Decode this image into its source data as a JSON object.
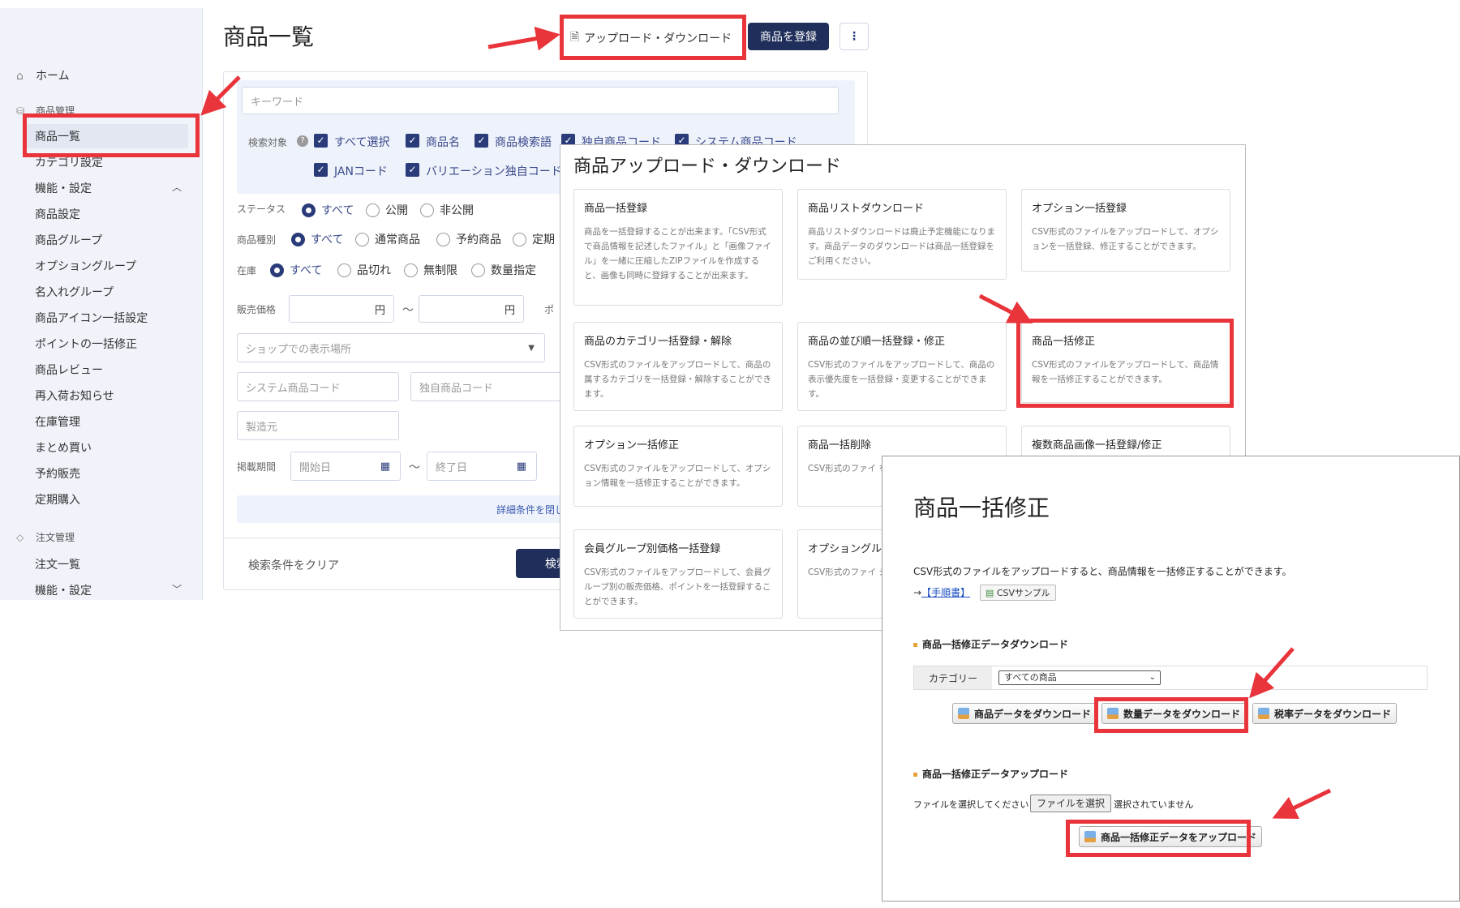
{
  "sidebar": {
    "home": "ホーム",
    "product_group": "商品管理",
    "product_items": [
      "商品一覧",
      "カテゴリ設定",
      "機能・設定",
      "商品設定",
      "商品グループ",
      "オプショングループ",
      "名入れグループ",
      "商品アイコン一括設定",
      "ポイントの一括修正",
      "商品レビュー",
      "再入荷お知らせ",
      "在庫管理",
      "まとめ買い",
      "予約販売",
      "定期購入"
    ],
    "order_group": "注文管理",
    "order_items": [
      "注文一覧",
      "機能・設定"
    ]
  },
  "main": {
    "title": "商品一覧",
    "upload_download_label": "アップロード・ダウンロード",
    "register_label": "商品を登録",
    "more_label": "⋮",
    "keyword_placeholder": "キーワード",
    "search_target_label": "検索対象",
    "search_targets": [
      "すべて選択",
      "商品名",
      "商品検索語",
      "独自商品コード",
      "システム商品コード",
      "JANコード",
      "バリエーション独自コード"
    ],
    "status_label": "ステータス",
    "status_options": [
      "すべて",
      "公開",
      "非公開"
    ],
    "type_label": "商品種別",
    "type_options": [
      "すべて",
      "通常商品",
      "予約商品",
      "定期"
    ],
    "stock_label": "在庫",
    "stock_options": [
      "すべて",
      "品切れ",
      "無制限",
      "数量指定"
    ],
    "price_label": "販売価格",
    "yen": "円",
    "tilde": "〜",
    "point_label": "ポ",
    "display_place_placeholder": "ショップでの表示場所",
    "system_code_placeholder": "システム商品コード",
    "own_code_placeholder": "独自商品コード",
    "maker_placeholder": "製造元",
    "period_label": "掲載期間",
    "start_date_placeholder": "開始日",
    "end_date_placeholder": "終了日",
    "detail_toggle": "詳細条件を閉じ",
    "clear_label": "検索条件をクリア",
    "search_label": "検索"
  },
  "dialog1": {
    "title": "商品アップロード・ダウンロード",
    "cards": [
      {
        "title": "商品一括登録",
        "desc": "商品を一括登録することが出来ます。「CSV形式で商品情報を記述したファイル」と「画像ファイル」を一緒に圧縮したZIPファイルを作成すると、画像も同時に登録することが出来ます。"
      },
      {
        "title": "商品リストダウンロード",
        "desc": "商品リストダウンロードは廃止予定機能になります。商品データのダウンロードは商品一括登録をご利用ください。"
      },
      {
        "title": "オプション一括登録",
        "desc": "CSV形式のファイルをアップロードして、オプションを一括登録、修正することができます。"
      },
      {
        "title": "商品のカテゴリ一括登録・解除",
        "desc": "CSV形式のファイルをアップロードして、商品の属するカテゴリを一括登録・解除することができます。"
      },
      {
        "title": "商品の並び順一括登録・修正",
        "desc": "CSV形式のファイルをアップロードして、商品の表示優先度を一括登録・変更することができます。"
      },
      {
        "title": "商品一括修正",
        "desc": "CSV形式のファイルをアップロードして、商品情報を一括修正することができます。"
      },
      {
        "title": "オプション一括修正",
        "desc": "CSV形式のファイルをアップロードして、オプション情報を一括修正することができます。"
      },
      {
        "title": "商品一括削除",
        "desc": "CSV形式のファイ を一括削除できま"
      },
      {
        "title": "複数商品画像一括登録/修正",
        "desc": ""
      },
      {
        "title": "会員グループ別価格一括登録",
        "desc": "CSV形式のファイルをアップロードして、会員グループ別の販売価格、ポイントを一括登録することができます。"
      },
      {
        "title": "オプショングル",
        "desc": "CSV形式のファイ ショングループ ます。"
      }
    ]
  },
  "dialog2": {
    "title": "商品一括修正",
    "intro": "CSV形式のファイルをアップロードすると、商品情報を一括修正することができます。",
    "manual_prefix": "→",
    "manual_link": "【手順書】",
    "csv_sample": "CSVサンプル",
    "download_section": "商品一括修正データダウンロード",
    "category_label": "カテゴリー",
    "category_value": "すべての商品",
    "btn_product_data": "商品データをダウンロード",
    "btn_quantity_data": "数量データをダウンロード",
    "btn_tax_data": "税率データをダウンロード",
    "upload_section": "商品一括修正データアップロード",
    "file_prompt": "ファイルを選択してください",
    "file_button": "ファイルを選択",
    "file_status": "選択されていません",
    "btn_upload": "商品一括修正データをアップロード"
  },
  "colors": {
    "highlight": "#e8343a",
    "primary": "#1f2e5a",
    "accent": "#2a3b7a"
  }
}
